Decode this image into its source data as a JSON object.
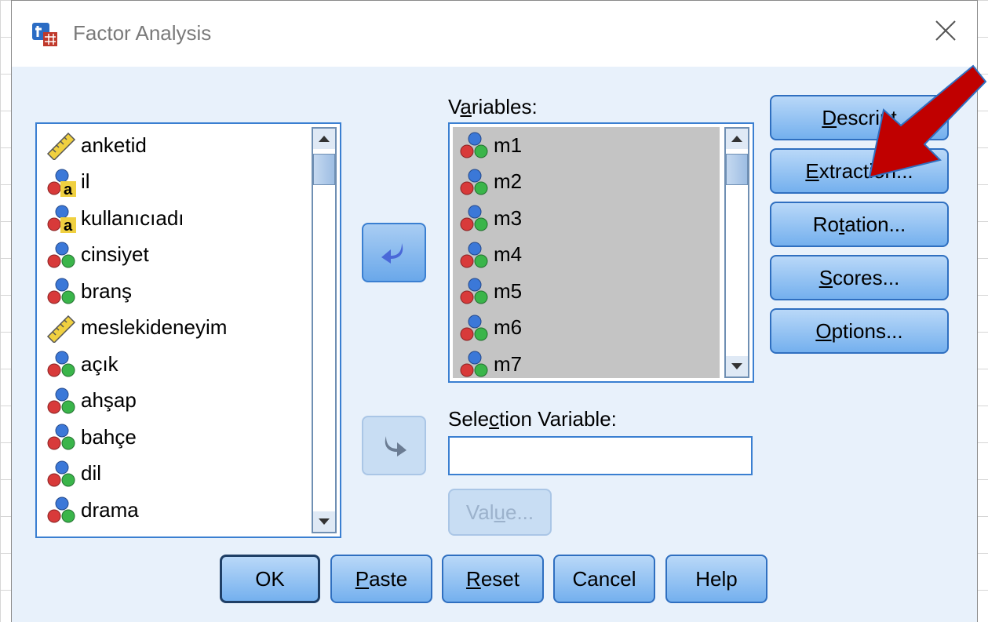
{
  "window": {
    "title": "Factor Analysis",
    "icon": "factor-analysis-app-icon",
    "close_icon": "close-icon"
  },
  "source_list": {
    "items": [
      {
        "label": "anketid",
        "icon": "scale-ruler-icon"
      },
      {
        "label": "il",
        "icon": "nominal-string-icon"
      },
      {
        "label": "kullanıcıadı",
        "icon": "nominal-string-icon"
      },
      {
        "label": "cinsiyet",
        "icon": "nominal-icon"
      },
      {
        "label": "branş",
        "icon": "nominal-icon"
      },
      {
        "label": "meslekideneyim",
        "icon": "scale-ruler-icon"
      },
      {
        "label": "açık",
        "icon": "nominal-icon"
      },
      {
        "label": "ahşap",
        "icon": "nominal-icon"
      },
      {
        "label": "bahçe",
        "icon": "nominal-icon"
      },
      {
        "label": "dil",
        "icon": "nominal-icon"
      },
      {
        "label": "drama",
        "icon": "nominal-icon"
      }
    ]
  },
  "variables": {
    "label_pre": "V",
    "label_u": "a",
    "label_post": "riables:",
    "items": [
      {
        "label": "m1",
        "icon": "nominal-icon"
      },
      {
        "label": "m2",
        "icon": "nominal-icon"
      },
      {
        "label": "m3",
        "icon": "nominal-icon"
      },
      {
        "label": "m4",
        "icon": "nominal-icon"
      },
      {
        "label": "m5",
        "icon": "nominal-icon"
      },
      {
        "label": "m6",
        "icon": "nominal-icon"
      },
      {
        "label": "m7",
        "icon": "nominal-icon"
      }
    ]
  },
  "selection_variable": {
    "label_pre": "Sele",
    "label_u": "c",
    "label_post": "tion Variable:",
    "value": ""
  },
  "value_button": {
    "pre": "Val",
    "u": "u",
    "post": "e..."
  },
  "side_buttons": {
    "descriptives": {
      "pre": "",
      "u": "D",
      "post": "escript"
    },
    "extraction": {
      "pre": "",
      "u": "E",
      "post": "xtraction..."
    },
    "rotation": {
      "pre": "Ro",
      "u": "t",
      "post": "ation..."
    },
    "scores": {
      "pre": "",
      "u": "S",
      "post": "cores..."
    },
    "options": {
      "pre": "",
      "u": "O",
      "post": "ptions..."
    }
  },
  "bottom_buttons": {
    "ok": "OK",
    "paste": {
      "u": "P",
      "post": "aste"
    },
    "reset": {
      "u": "R",
      "post": "eset"
    },
    "cancel": "Cancel",
    "help": "Help"
  },
  "colors": {
    "accent": "#3a7fd1",
    "dialog_bg": "#e8f1fb",
    "annotation_arrow": "#c00000"
  }
}
